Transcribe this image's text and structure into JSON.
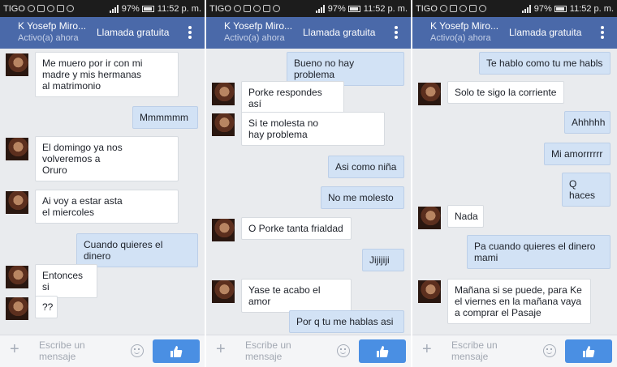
{
  "status": {
    "carrier": "TIGO",
    "battery": "97%",
    "time": "11:52 p. m."
  },
  "header": {
    "contact_name": "K Yosefp Miro...",
    "status_text": "Activo(a) ahora",
    "call_label": "Llamada gratuita"
  },
  "composer": {
    "placeholder": "Escribe un\nmensaje"
  },
  "screens": [
    {
      "messages": [
        {
          "dir": "in",
          "text": "Me muero por ir con mi\nmadre y mis hermanas\nal matrimonio"
        },
        {
          "dir": "out",
          "text": "Mmmmmm"
        },
        {
          "dir": "in",
          "text": "El domingo ya nos\nvolveremos a\nOruro"
        },
        {
          "dir": "in",
          "text": "Ai voy a estar asta\nel miercoles"
        },
        {
          "dir": "out",
          "text": "Cuando quieres el dinero"
        },
        {
          "dir": "in",
          "text": "Entonces si"
        },
        {
          "dir": "in",
          "text": "??"
        }
      ]
    },
    {
      "messages": [
        {
          "dir": "out",
          "text": "Bueno no hay problema"
        },
        {
          "dir": "in",
          "text": "Porke respondes así"
        },
        {
          "dir": "in",
          "text": "Si te molesta no\nhay problema"
        },
        {
          "dir": "out",
          "text": "Asi como niña"
        },
        {
          "dir": "out",
          "text": "No me molesto"
        },
        {
          "dir": "in",
          "text": "O Porke tanta frialdad"
        },
        {
          "dir": "out",
          "text": "Jijijiji"
        },
        {
          "dir": "in",
          "text": "Yase te acabo el amor"
        },
        {
          "dir": "out",
          "text": "Por q tu me hablas asi"
        }
      ]
    },
    {
      "messages": [
        {
          "dir": "out",
          "text": "Te hablo como tu me habls"
        },
        {
          "dir": "in",
          "text": "Solo te sigo la corriente"
        },
        {
          "dir": "out",
          "text": "Ahhhhh"
        },
        {
          "dir": "out",
          "text": "Mi amorrrrrr"
        },
        {
          "dir": "out",
          "text": "Q haces"
        },
        {
          "dir": "in",
          "text": "Nada"
        },
        {
          "dir": "out",
          "text": "Pa cuando quieres el dinero\nmami"
        },
        {
          "dir": "in",
          "text": "Mañana si se puede, para Ke\nel viernes en la mañana vaya\na comprar el Pasaje"
        }
      ]
    }
  ]
}
